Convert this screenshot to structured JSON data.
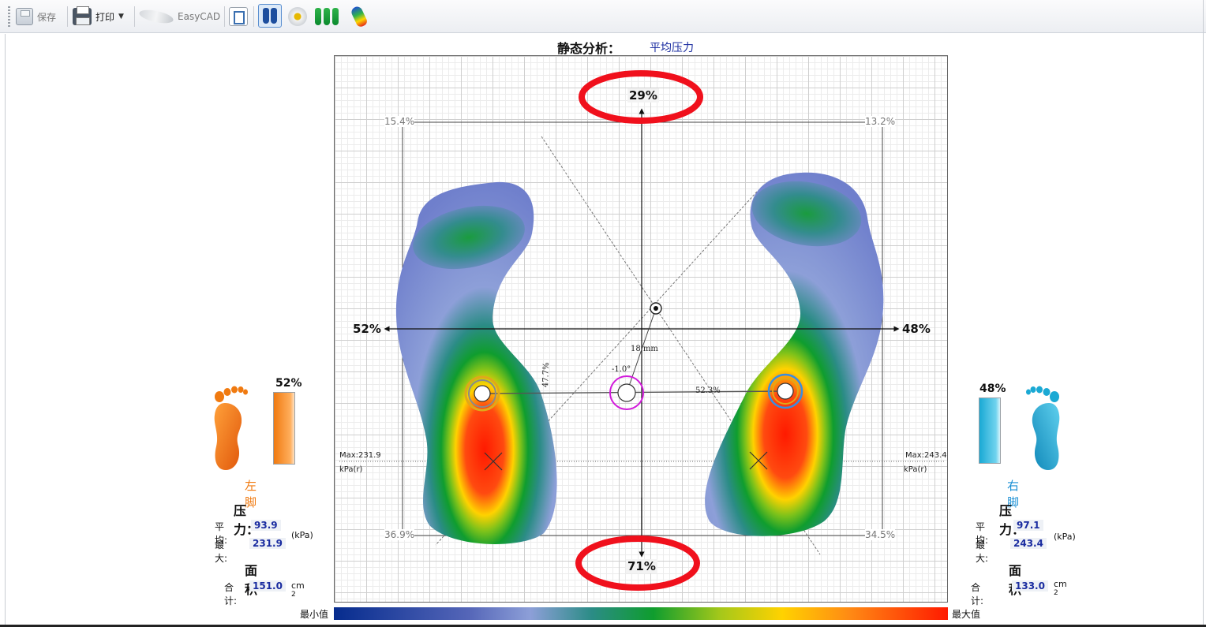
{
  "toolbar": {
    "save_label": "保存",
    "print_label": "打印",
    "easycad_label": "EasyCAD"
  },
  "header": {
    "title": "静态分析：",
    "subtitle": "平均压力"
  },
  "plot": {
    "front_pct": "29%",
    "back_pct": "71%",
    "left_pct": "52%",
    "right_pct": "48%",
    "quad_top_left": "15.4%",
    "quad_top_right": "13.2%",
    "quad_bottom_left": "36.9%",
    "quad_bottom_right": "34.5%",
    "left_max": "Max:231.9",
    "left_unit": "kPa(r)",
    "right_max": "Max:243.4",
    "right_unit": "kPa(r)",
    "cop_distance": "18 mm",
    "cop_angle": "-1.0°",
    "left_cop_pct": "47.7%",
    "right_cop_pct": "52.3%",
    "highlight_color": "#f0101c"
  },
  "legend": {
    "min_label": "最小值",
    "max_label": "最大值"
  },
  "left_foot": {
    "name": "左脚",
    "load_pct": "52%",
    "load_fraction": 0.52,
    "color": "#f07a10",
    "pressure_title": "压力：",
    "avg_label": "平均:",
    "avg_value": "93.9",
    "max_label": "最大:",
    "max_value": "231.9",
    "pressure_unit": "(kPa)",
    "area_title": "面积",
    "total_label": "合计:",
    "total_value": "151.0",
    "area_unit": "cm",
    "area_unit_sup": "2"
  },
  "right_foot": {
    "name": "右脚",
    "load_pct": "48%",
    "load_fraction": 0.48,
    "color": "#1aa9d4",
    "pressure_title": "压力：",
    "avg_label": "平均:",
    "avg_value": "97.1",
    "max_label": "最大:",
    "max_value": "243.4",
    "pressure_unit": "(kPa)",
    "area_title": "面积",
    "total_label": "合计:",
    "total_value": "133.0",
    "area_unit": "cm",
    "area_unit_sup": "2"
  }
}
